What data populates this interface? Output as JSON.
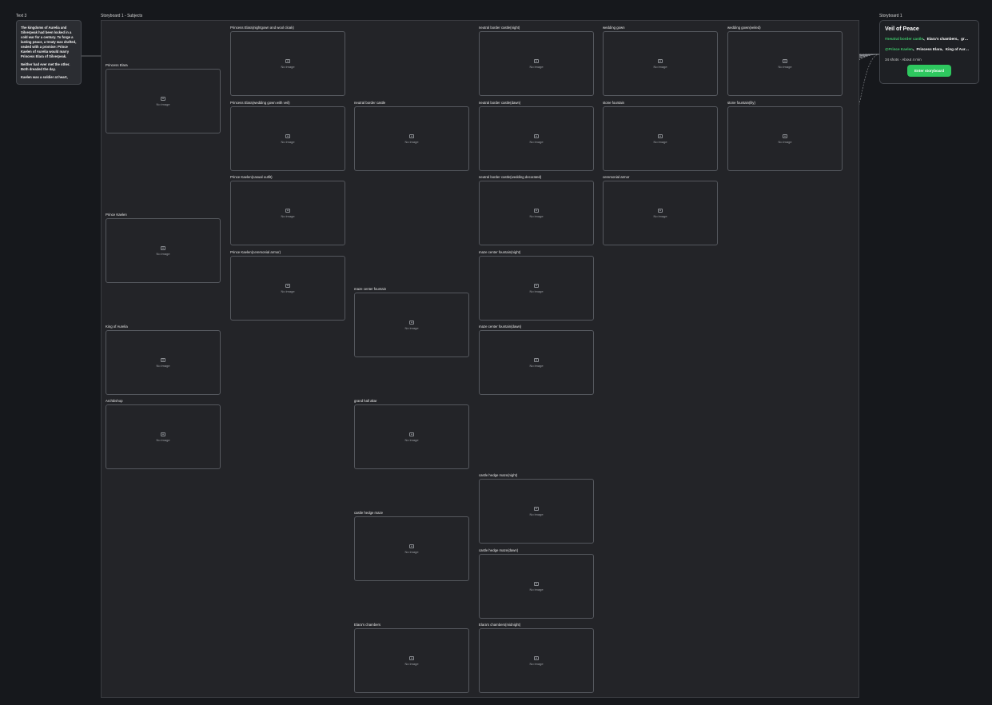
{
  "text_node": {
    "title": "Text 3",
    "paragraphs": [
      "The kingdoms of Aurelia and Silverpeak had been locked in a cold war for a century. To forge a lasting peace, a treaty was drafted, sealed with a promise: Prince Kaelen of Aurelia would marry Princess Elara of Silverpeak.",
      "Neither had ever met the other. Both dreaded the day.",
      "Kaelen was a soldier at heart,"
    ]
  },
  "board": {
    "title": "Storyboard 1 - Subjects"
  },
  "no_image_text": "No image",
  "cards": [
    {
      "name": "princess-elara",
      "label": "Princess Elara"
    },
    {
      "name": "prince-kaelen",
      "label": "Prince Kaelen"
    },
    {
      "name": "king-of-aurelia",
      "label": "King of Aurelia"
    },
    {
      "name": "archbishop",
      "label": "Archbishop"
    },
    {
      "name": "elara-nightgown",
      "label": "Princess Elara(nightgown and wool cloak)"
    },
    {
      "name": "elara-wedding-gown",
      "label": "Princess Elara(wedding gown with veil)"
    },
    {
      "name": "kaelen-casual",
      "label": "Prince Kaelen(casual outfit)"
    },
    {
      "name": "kaelen-armor",
      "label": "Prince Kaelen(ceremonial armor)"
    },
    {
      "name": "neutral-border-castle",
      "label": "neutral border castle"
    },
    {
      "name": "maze-center-fountain",
      "label": "maze center fountain"
    },
    {
      "name": "grand-hall-altar",
      "label": "grand hall altar"
    },
    {
      "name": "castle-hedge-maze",
      "label": "castle hedge maze"
    },
    {
      "name": "elaras-chambers",
      "label": "Elara's chambers"
    },
    {
      "name": "castle-night",
      "label": "neutral border castle(night)"
    },
    {
      "name": "castle-dawn",
      "label": "neutral border castle(dawn)"
    },
    {
      "name": "castle-wedding-decorated",
      "label": "neutral border castle(wedding decorated)"
    },
    {
      "name": "fountain-night",
      "label": "maze center fountain(night)"
    },
    {
      "name": "fountain-dawn",
      "label": "maze center fountain(dawn)"
    },
    {
      "name": "maze-night",
      "label": "castle hedge maze(night)"
    },
    {
      "name": "maze-dawn",
      "label": "castle hedge maze(dawn)"
    },
    {
      "name": "chambers-midnight",
      "label": "Elara's chambers(midnight)"
    },
    {
      "name": "wedding-gown",
      "label": "wedding gown"
    },
    {
      "name": "stone-fountain",
      "label": "stone fountain"
    },
    {
      "name": "ceremonial-armor",
      "label": "ceremonial armor"
    },
    {
      "name": "wedding-gown-veiled",
      "label": "wedding gown(veiled)"
    },
    {
      "name": "stone-fountain-lily",
      "label": "stone fountain(lily)"
    }
  ],
  "storyboard": {
    "node_title": "Storyboard 1",
    "title": "Veil of Peace",
    "locations_tag": "#neutral border castle",
    "locations_rest": "Elara's chambers、gr…",
    "characters_tag": "@Prince Kaelen",
    "characters_rest": "Princess Elara、King of Aur…",
    "meta": "34 shots · About 4 min",
    "enter_label": "Enter storyboard"
  }
}
